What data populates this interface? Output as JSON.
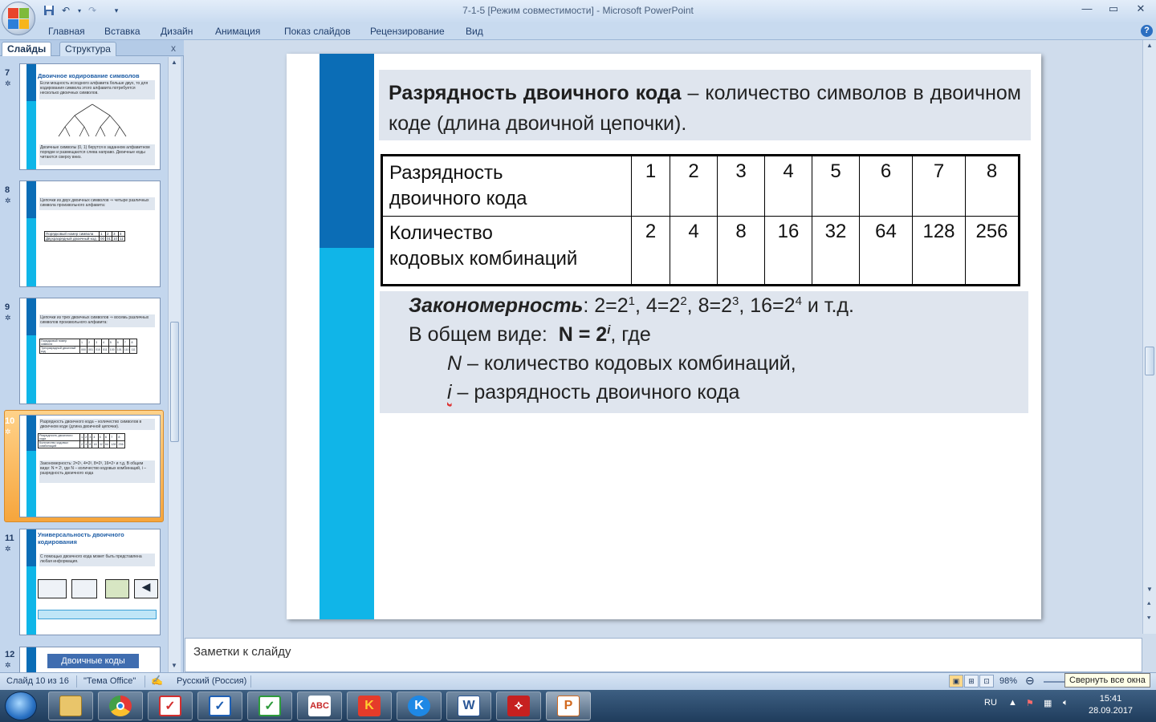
{
  "window": {
    "title": "7-1-5 [Режим совместимости] - Microsoft PowerPoint",
    "min_glyph": "—",
    "max_glyph": "▭",
    "close_glyph": "✕"
  },
  "ribbon": {
    "tabs": [
      "Главная",
      "Вставка",
      "Дизайн",
      "Анимация",
      "Показ слайдов",
      "Рецензирование",
      "Вид"
    ],
    "help_glyph": "?"
  },
  "left_pane": {
    "tabs": [
      "Слайды",
      "Структура"
    ],
    "close_glyph": "x",
    "thumbnails": [
      {
        "num": "7",
        "title": "Двоичное кодирование символов",
        "text": "Если мощность исходного алфавита больше двух, то для кодирования символа этого алфавита потребуется несколько двоичных символов.",
        "text2": "Двоичные символы (0, 1) берутся в заданном алфавитном порядке и размещаются слева направо. Двоичные коды читаются сверху вниз."
      },
      {
        "num": "8",
        "text": "Цепочки из двух двоичных символов ⇒ четыре различных символа произвольного алфавита:",
        "row1": [
          "Порядковый номер символа",
          "1",
          "2",
          "3",
          "4"
        ],
        "row2": [
          "Двухразрядный двоичный код",
          "00",
          "01",
          "10",
          "11"
        ]
      },
      {
        "num": "9",
        "text": "Цепочки из трех двоичных символов ⇒ восемь различных символов произвольного алфавита:",
        "row1": [
          "Порядковый номер символа",
          "1",
          "2",
          "3",
          "4",
          "5",
          "6",
          "7",
          "8"
        ],
        "row2": [
          "Трехразрядный двоичный код",
          "000",
          "001",
          "010",
          "011",
          "100",
          "101",
          "110",
          "111"
        ]
      },
      {
        "num": "10",
        "text": "Разрядность двоичного кода – количество символов в двоичном коде (длина двоичной цепочки).",
        "text2": "Закономерность: 2=2¹, 4=2², 8=2³, 16=2⁴ и т.д. В общем виде: N = 2ⁱ, где N – количество кодовых комбинаций, i – разрядность двоичного кода"
      },
      {
        "num": "11",
        "title": "Универсальность двоичного кодирования",
        "text": "С помощью двоичного кода может быть представлена любая информация."
      },
      {
        "num": "12",
        "title": "Двоичные коды"
      }
    ]
  },
  "slide": {
    "definition_bold": "Разрядность двоичного кода",
    "definition_rest": " – количество символов в двоичном коде (длина двоичной цепочки).",
    "table": {
      "row1_label": [
        "Разрядность",
        "двоичного кода"
      ],
      "row1_values": [
        "1",
        "2",
        "3",
        "4",
        "5",
        "6",
        "7",
        "8"
      ],
      "row2_label": [
        "Количество",
        "кодовых комбинаций"
      ],
      "row2_values": [
        "2",
        "4",
        "8",
        "16",
        "32",
        "64",
        "128",
        "256"
      ]
    },
    "law": {
      "label": "Закономерность",
      "examples": [
        {
          "n": "2",
          "exp": "1"
        },
        {
          "n": "4",
          "exp": "2"
        },
        {
          "n": "8",
          "exp": "3"
        },
        {
          "n": "16",
          "exp": "4"
        }
      ],
      "etc": " и т.д.",
      "general_prefix": "В общем виде:  ",
      "formula": "N = 2",
      "formula_exp": "i",
      "general_suffix": ", где",
      "n_symbol": "N",
      "n_text": " – количество кодовых комбинаций,",
      "i_symbol": "i",
      "i_text": " – разрядность двоичного кода"
    }
  },
  "notes": {
    "placeholder": "Заметки к слайду"
  },
  "status": {
    "slide_counter": "Слайд 10 из 16",
    "theme": "\"Тема Office\"",
    "language": "Русский (Россия)",
    "zoom": "98%",
    "tooltip": "Свернуть все окна"
  },
  "taskbar": {
    "lang": "RU",
    "time": "15:41",
    "date": "28.09.2017"
  },
  "colors": {
    "band_dark": "#0b6db6",
    "band_light": "#10b5e8",
    "selection": "#f6a53c"
  }
}
